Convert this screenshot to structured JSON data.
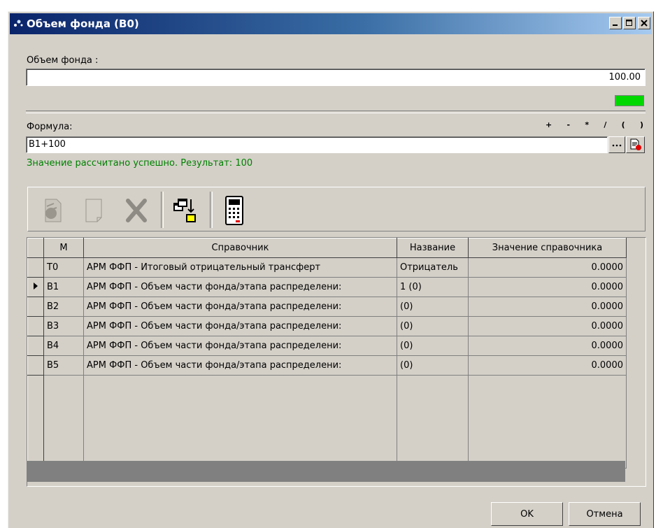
{
  "window": {
    "title": "Объем фонда (В0)"
  },
  "fund": {
    "label": "Объем фонда :",
    "value": "100.00",
    "status_color": "#00d800"
  },
  "formula": {
    "label": "Формула:",
    "operators": [
      "+",
      "-",
      "*",
      "/",
      "(",
      ")"
    ],
    "value": "B1+100",
    "result_message": "Значение рассчитано успешно. Результат: 100",
    "result_color": "#008000"
  },
  "toolbar": {
    "buttons": [
      "add-record-icon",
      "new-document-icon",
      "delete-icon",
      "copy-move-icon",
      "calculator-icon"
    ]
  },
  "grid": {
    "columns": [
      "М",
      "Справочник",
      "Название",
      "Значение справочника"
    ],
    "rows": [
      {
        "m": "T0",
        "ref": "АРМ ФФП - Итоговый отрицательный трансферт",
        "name": "Отрицатель",
        "value": "0.0000"
      },
      {
        "m": "B1",
        "ref": "АРМ ФФП - Объем части фонда/этапа распределени:",
        "name": "1 (0)",
        "value": "0.0000"
      },
      {
        "m": "B2",
        "ref": "АРМ ФФП - Объем части фонда/этапа распределени:",
        "name": "(0)",
        "value": "0.0000"
      },
      {
        "m": "B3",
        "ref": "АРМ ФФП - Объем части фонда/этапа распределени:",
        "name": "(0)",
        "value": "0.0000"
      },
      {
        "m": "B4",
        "ref": "АРМ ФФП - Объем части фонда/этапа распределени:",
        "name": "(0)",
        "value": "0.0000"
      },
      {
        "m": "B5",
        "ref": "АРМ ФФП - Объем части фонда/этапа распределени:",
        "name": "(0)",
        "value": "0.0000"
      }
    ],
    "current_row": 1
  },
  "buttons": {
    "ok": "OK",
    "cancel": "Отмена"
  }
}
